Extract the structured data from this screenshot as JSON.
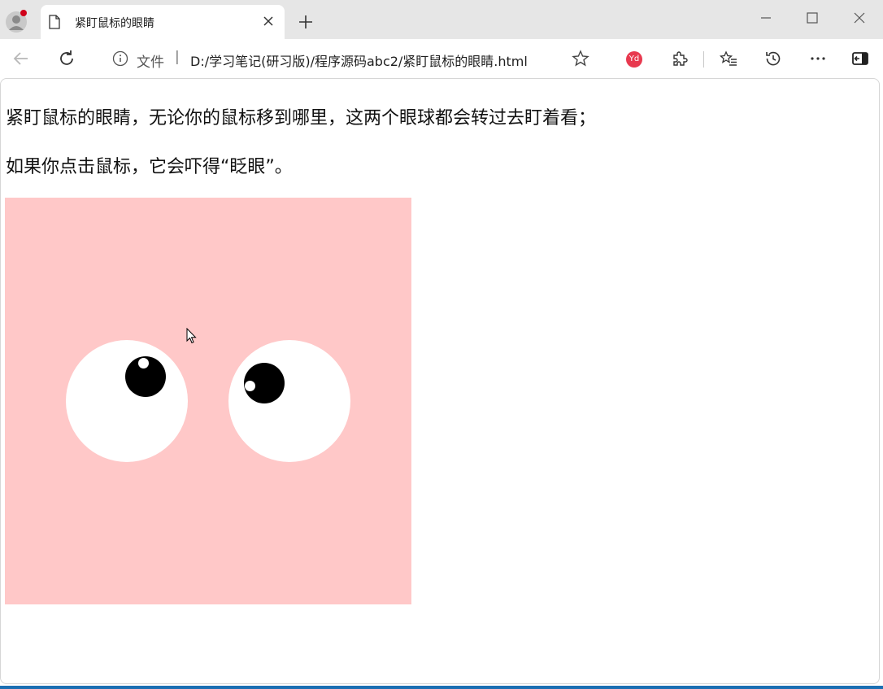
{
  "tab": {
    "title": "紧盯鼠标的眼睛",
    "close_icon": "close-icon"
  },
  "address_bar": {
    "security_label": "文件",
    "separator": "|",
    "url": "D:/学习笔记(研习版)/程序源码abc2/紧盯鼠标的眼睛.html"
  },
  "extensions": {
    "yd_label": "Yd"
  },
  "page": {
    "line1": "紧盯鼠标的眼睛，无论你的鼠标移到哪里，这两个眼球都会转过去盯着看；",
    "line2": "如果你点击鼠标，它会吓得“眨眼”。",
    "box_color": "#ffc8c8",
    "eye_color": "#ffffff",
    "pupil_color": "#000000"
  },
  "colors": {
    "tab_strip": "#e6e6e6",
    "accent": "#1b6fb3"
  }
}
